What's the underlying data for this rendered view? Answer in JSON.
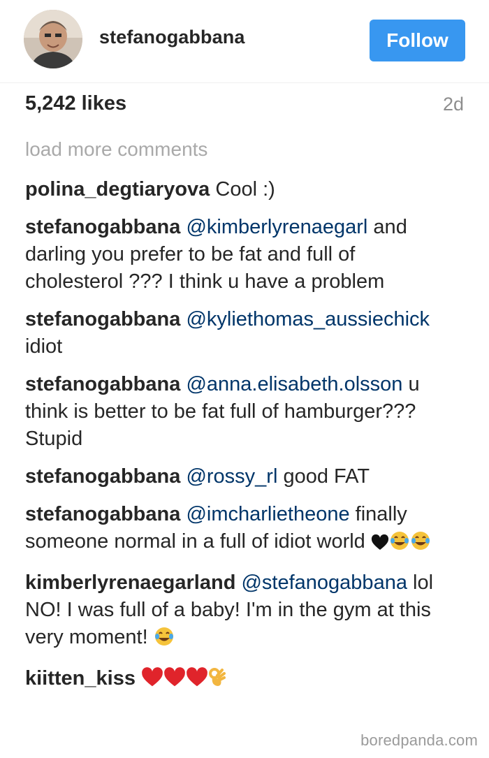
{
  "post": {
    "username": "stefanogabbana",
    "follow_label": "Follow",
    "likes": "5,242 likes",
    "time_ago": "2d",
    "load_more": "load more comments"
  },
  "comments": [
    {
      "user": "polina_degtiaryova",
      "mention": "",
      "text": " Cool :)"
    },
    {
      "user": "stefanogabbana",
      "mention": "@kimberlyrenaegarl",
      "text": " and darling you prefer to be fat and full of cholesterol ??? I think u have a problem"
    },
    {
      "user": "stefanogabbana",
      "mention": "@kyliethomas_aussiechick",
      "text": " idiot"
    },
    {
      "user": "stefanogabbana",
      "mention": "@anna.elisabeth.olsson",
      "text": " u think is better to be fat full of hamburger??? Stupid"
    },
    {
      "user": "stefanogabbana",
      "mention": "@rossy_rl",
      "text": " good FAT"
    },
    {
      "user": "stefanogabbana",
      "mention": "@imcharlietheone",
      "text": " finally someone normal in a full of idiot world"
    },
    {
      "user": "kimberlyrenaegarland",
      "mention": "@stefanogabbana",
      "text": " lol NO! I was full of a baby! I'm in the gym at this very moment!"
    },
    {
      "user": "kiitten_kiss",
      "mention": "",
      "text": ""
    }
  ],
  "icons": {
    "heart": "black-heart-icon",
    "laugh": "tears-of-joy-icon",
    "red_heart": "red-heart-icon",
    "ok_hand": "ok-hand-icon"
  },
  "colors": {
    "follow_button": "#3897f0",
    "mention": "#003569",
    "muted": "#8e8e8e"
  },
  "watermark": "boredpanda.com"
}
